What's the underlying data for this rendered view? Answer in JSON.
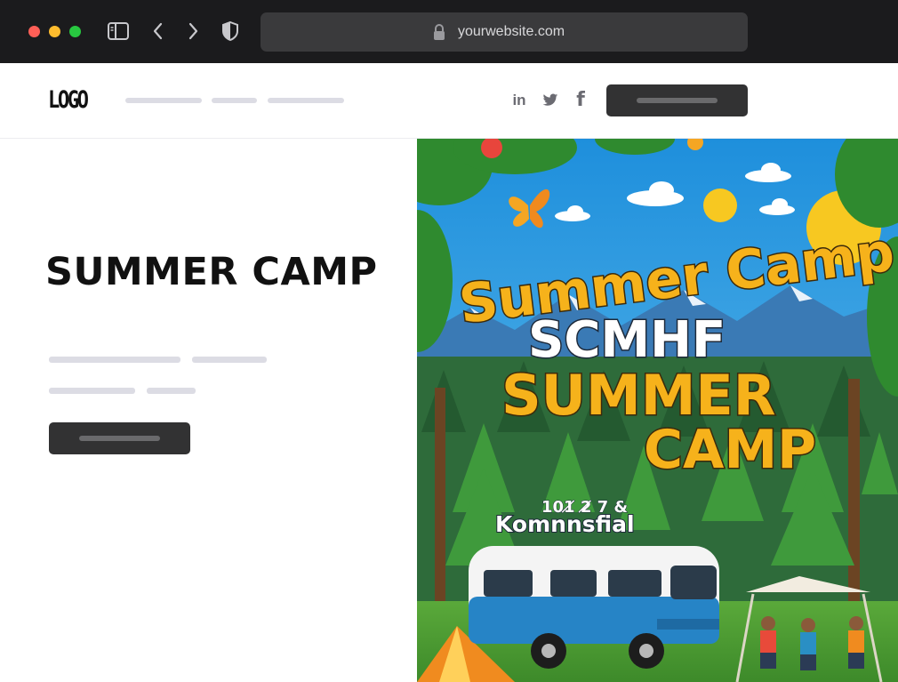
{
  "browser": {
    "url": "yourwebsite.com",
    "icons": [
      "sidebar-icon",
      "back-chevron-icon",
      "forward-chevron-icon",
      "shield-icon",
      "lock-icon"
    ]
  },
  "header": {
    "logo_text": "LOGO",
    "social_icons": [
      "linkedin-icon",
      "twitter-icon",
      "facebook-icon"
    ],
    "linkedin_glyph": "in",
    "facebook_glyph": "f"
  },
  "hero": {
    "title": "SUMMER CAMP"
  },
  "poster": {
    "line1": "Summer Camp",
    "line2": "SCMHF",
    "line3": "SUMMER",
    "line4": "CAMP",
    "date_line": "101̸ 2̸ 7 &",
    "sub_line": "Komnnsfial"
  },
  "colors": {
    "chrome_bg": "#1b1b1d",
    "urlbar_bg": "#3a3a3c",
    "button_dark": "#323233",
    "placeholder_line": "#dcdce4",
    "poster_title_yellow": "#f6b21b",
    "poster_sky": "#2a9fe3",
    "poster_van_blue": "#2684c6"
  }
}
